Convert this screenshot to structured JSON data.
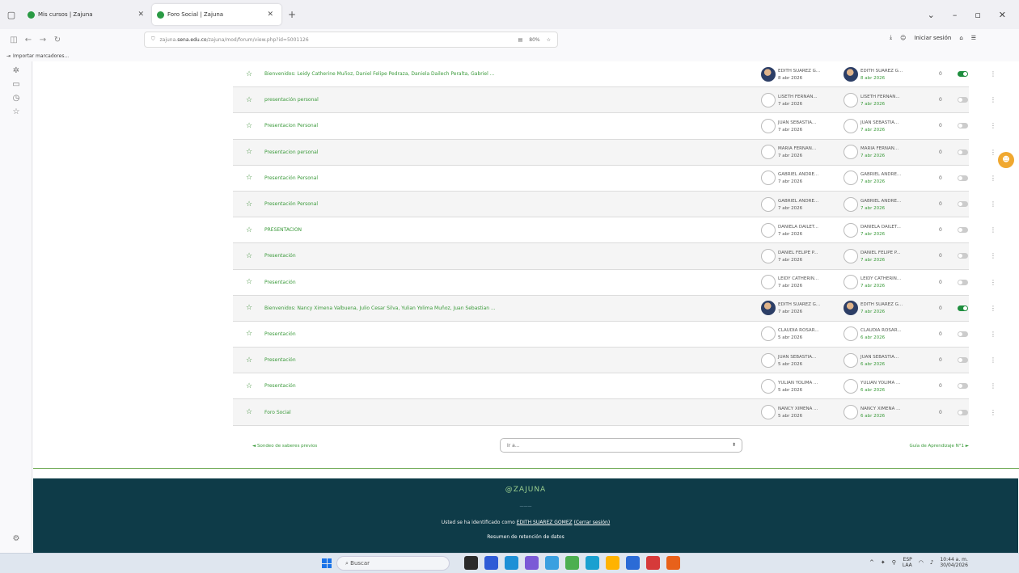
{
  "browser": {
    "tabs": [
      {
        "title": "Mis cursos | Zajuna",
        "active": false
      },
      {
        "title": "Foro Social | Zajuna",
        "active": true
      }
    ],
    "new_tab": "+",
    "url_prefix": "zajuna.",
    "url_host": "sena.edu.co",
    "url_path": "/zajuna/mod/forum/view.php?id=5001126",
    "zoom": "80%",
    "signin": "Iniciar sesión",
    "bookmarks_import": "Importar marcadores..."
  },
  "rows": [
    {
      "discussion": "Bienvenidos: Leidy Catherine Muñoz, Daniel Felipe Pedraza, Daniela Dailech Peralta, Gabriel ...",
      "starter": "EDITH SUAREZ G...",
      "started": "8 abr 2026",
      "last_user": "EDITH SUAREZ G...",
      "last_date": "8 abr 2026",
      "replies": "0",
      "photo": true,
      "subscribed": true
    },
    {
      "discussion": "presentación personal",
      "starter": "LISETH FERNAN...",
      "started": "7 abr 2026",
      "last_user": "LISETH FERNAN...",
      "last_date": "7 abr 2026",
      "replies": "0",
      "photo": false,
      "subscribed": false
    },
    {
      "discussion": "Presentacion Personal",
      "starter": "JUAN SEBASTIA...",
      "started": "7 abr 2026",
      "last_user": "JUAN SEBASTIA...",
      "last_date": "7 abr 2026",
      "replies": "0",
      "photo": false,
      "subscribed": false
    },
    {
      "discussion": "Presentacion personal",
      "starter": "MARIA FERNAN...",
      "started": "7 abr 2026",
      "last_user": "MARIA FERNAN...",
      "last_date": "7 abr 2026",
      "replies": "0",
      "photo": false,
      "subscribed": false
    },
    {
      "discussion": "Presentación Personal",
      "starter": "GABRIEL ANDRE...",
      "started": "7 abr 2026",
      "last_user": "GABRIEL ANDRE...",
      "last_date": "7 abr 2026",
      "replies": "0",
      "photo": false,
      "subscribed": false
    },
    {
      "discussion": "Presentación Personal",
      "starter": "GABRIEL ANDRE...",
      "started": "7 abr 2026",
      "last_user": "GABRIEL ANDRE...",
      "last_date": "7 abr 2026",
      "replies": "0",
      "photo": false,
      "subscribed": false
    },
    {
      "discussion": "PRESENTACION",
      "starter": "DANIELA DAILET...",
      "started": "7 abr 2026",
      "last_user": "DANIELA DAILET...",
      "last_date": "7 abr 2026",
      "replies": "0",
      "photo": false,
      "subscribed": false
    },
    {
      "discussion": "Presentación",
      "starter": "DANIEL FELIPE P...",
      "started": "7 abr 2026",
      "last_user": "DANIEL FELIPE P...",
      "last_date": "7 abr 2026",
      "replies": "0",
      "photo": false,
      "subscribed": false
    },
    {
      "discussion": "Presentación",
      "starter": "LEIDY CATHERIN...",
      "started": "7 abr 2026",
      "last_user": "LEIDY CATHERIN...",
      "last_date": "7 abr 2026",
      "replies": "0",
      "photo": false,
      "subscribed": false
    },
    {
      "discussion": "Bienvenidos: Nancy Ximena Valbuena, Julio Cesar Silva, Yulian Yolima Muñoz, Juan Sebastian ...",
      "starter": "EDITH SUAREZ G...",
      "started": "7 abr 2026",
      "last_user": "EDITH SUAREZ G...",
      "last_date": "7 abr 2026",
      "replies": "0",
      "photo": true,
      "subscribed": true
    },
    {
      "discussion": "Presentación",
      "starter": "CLAUDIA ROSAR...",
      "started": "5 abr 2026",
      "last_user": "CLAUDIA ROSAR...",
      "last_date": "6 abr 2026",
      "replies": "0",
      "photo": false,
      "subscribed": false
    },
    {
      "discussion": "Presentación",
      "starter": "JUAN SEBASTIA...",
      "started": "5 abr 2026",
      "last_user": "JUAN SEBASTIA...",
      "last_date": "6 abr 2026",
      "replies": "0",
      "photo": false,
      "subscribed": false
    },
    {
      "discussion": "Presentación",
      "starter": "YULIAN YOLIMA ...",
      "started": "5 abr 2026",
      "last_user": "YULIAN YOLIMA ...",
      "last_date": "6 abr 2026",
      "replies": "0",
      "photo": false,
      "subscribed": false
    },
    {
      "discussion": "Foro Social",
      "starter": "NANCY XIMENA ...",
      "started": "5 abr 2026",
      "last_user": "NANCY XIMENA ...",
      "last_date": "6 abr 2026",
      "replies": "0",
      "photo": false,
      "subscribed": false
    }
  ],
  "pager": {
    "prev": "◄ Sondeo de saberes previos",
    "jump_placeholder": "Ir a...",
    "next": "Guía de Aprendizaje N°1 ►"
  },
  "footer": {
    "logo": "@ZAJUNA",
    "separator": "———",
    "user_prefix": "Usted se ha identificado como",
    "user_name": "EDITH SUAREZ GOMEZ",
    "logout": "(Cerrar sesión)",
    "retention": "Resumen de retención de datos"
  },
  "taskbar": {
    "search": "Buscar",
    "lang": "ESP",
    "lang_sub": "LAA",
    "time": "10:44 a. m.",
    "date": "30/04/2026"
  },
  "colors": {
    "accent": "#3a9a3a",
    "footer": "#0e3b48",
    "toggle_on": "#1e8e3e"
  }
}
